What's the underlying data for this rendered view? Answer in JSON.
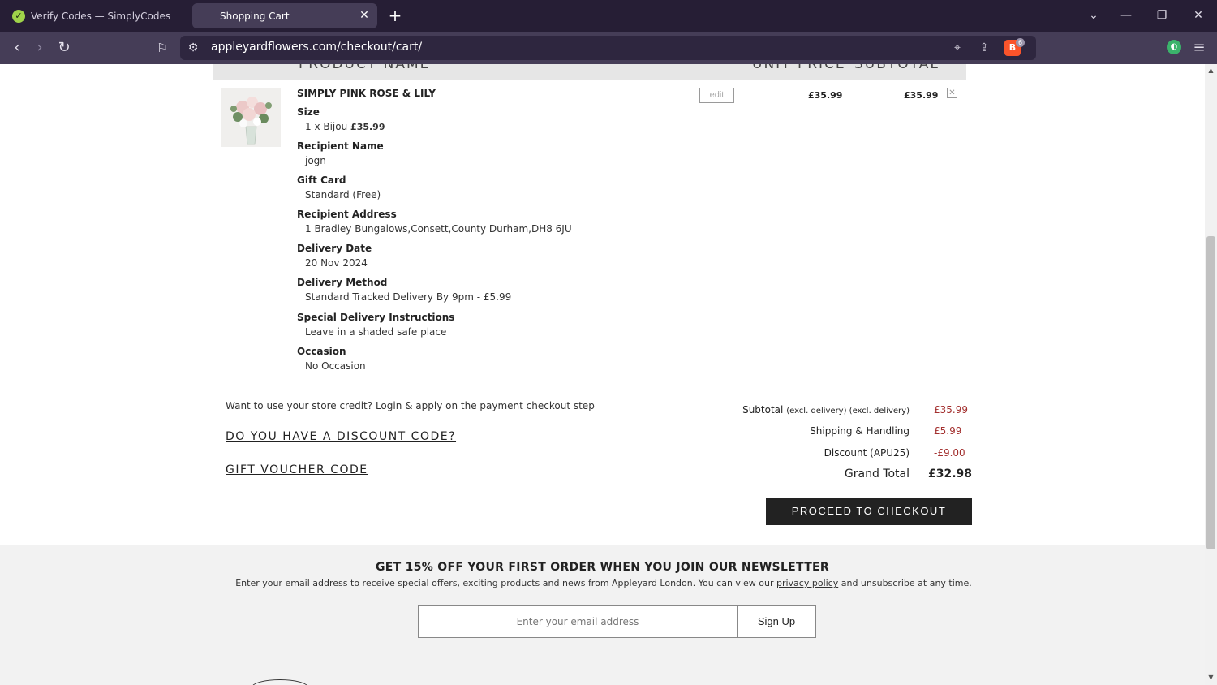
{
  "browser": {
    "tabs": [
      {
        "title": "Verify Codes — SimplyCodes",
        "active": false
      },
      {
        "title": "Shopping Cart",
        "active": true
      }
    ],
    "url": "appleyardflowers.com/checkout/cart/",
    "shield_count": "6"
  },
  "cart": {
    "header": {
      "product_name": "PRODUCT NAME",
      "unit_price": "UNIT PRICE",
      "subtotal": "SUBTOTAL"
    },
    "item": {
      "name": "SIMPLY PINK ROSE & LILY",
      "edit_label": "edit",
      "unit_price": "£35.99",
      "subtotal": "£35.99",
      "options": [
        {
          "label": "Size",
          "value": "1 x Bijou",
          "value_price": "£35.99"
        },
        {
          "label": "Recipient Name",
          "value": "jogn"
        },
        {
          "label": "Gift Card",
          "value": "Standard (Free)"
        },
        {
          "label": "Recipient Address",
          "value": "1 Bradley Bungalows,Consett,County Durham,DH8 6JU"
        },
        {
          "label": "Delivery Date",
          "value": "20 Nov 2024"
        },
        {
          "label": "Delivery Method",
          "value": "Standard Tracked Delivery By 9pm - £5.99"
        },
        {
          "label": "Special Delivery Instructions",
          "value": "Leave in a shaded safe place"
        },
        {
          "label": "Occasion",
          "value": "No Occasion"
        }
      ]
    }
  },
  "promo": {
    "store_credit": "Want to use your store credit? Login & apply on the payment checkout step",
    "discount_link": "DO YOU HAVE A DISCOUNT CODE?",
    "voucher_link": "GIFT VOUCHER CODE"
  },
  "totals": {
    "subtotal_label": "Subtotal",
    "subtotal_note": "(excl. delivery) (excl. delivery)",
    "subtotal_value": "£35.99",
    "shipping_label": "Shipping & Handling",
    "shipping_value": "£5.99",
    "discount_label": "Discount (APU25)",
    "discount_value": "-£9.00",
    "grand_label": "Grand Total",
    "grand_value": "£32.98",
    "checkout_label": "PROCEED TO CHECKOUT"
  },
  "newsletter": {
    "title": "GET 15% OFF YOUR FIRST ORDER WHEN YOU JOIN OUR NEWSLETTER",
    "desc_before": "Enter your email address to receive special offers, exciting products and news from Appleyard London. You can view our ",
    "privacy_link": "privacy policy",
    "desc_after": " and unsubscribe at any time.",
    "email_placeholder": "Enter your email address",
    "signup_label": "Sign Up"
  }
}
